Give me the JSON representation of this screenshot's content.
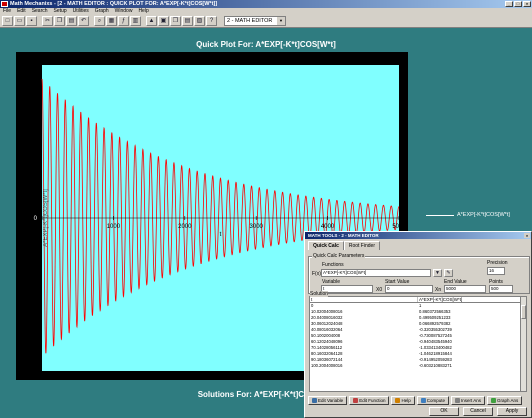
{
  "window": {
    "title": "Math Mechanixs - [2 - MATH EDITOR : QUICK PLOT FOR: A*EXP[-K*t]COS[W*t]]",
    "controls": [
      "_",
      "□",
      "×"
    ]
  },
  "menu": [
    "File",
    "Edit",
    "Search",
    "Setup",
    "Utilities",
    "Graph",
    "Window",
    "Help"
  ],
  "toolbar": {
    "combo_value": "2 - MATH EDITOR"
  },
  "plot": {
    "title": "Quick Plot For: A*EXP[-K*t]COS[W*t]",
    "footer": "Solutions For: A*EXP[-K*t]COS[W*t]",
    "legend": "A*EXP[-K*t]COS[W*t]",
    "ylabel": "A*EXP[-K*t]COS[W*t]",
    "xlabel": "t",
    "xticks": [
      "0",
      "1000",
      "2000",
      "3000",
      "4000",
      "5000"
    ],
    "y_zero_label": "0",
    "colors": {
      "background": "#80ffff",
      "curve": "#ff0000",
      "frame": "#000000",
      "axis": "#000000"
    }
  },
  "chart_data": {
    "type": "line",
    "title": "Quick Plot For: A*EXP[-K*t]COS[W*t]",
    "xlabel": "t",
    "ylabel": "A*EXP[-K*t]COS[W*t]",
    "xlim": [
      0,
      5000
    ],
    "ylim": [
      -1.1,
      1.1
    ],
    "grid": false,
    "legend_placement": "right-outside",
    "series": [
      {
        "name": "A*EXP[-K*t]COS[W*t]",
        "A": 1,
        "K": 0.0005,
        "cycles_over_range": 46
      }
    ]
  },
  "dialog": {
    "title": "MATH TOOLS - 2 - MATH EDITOR",
    "tabs": [
      "Quick Calc",
      "Root Finder"
    ],
    "params_group": "Quick Calc Parameters",
    "functions_label": "Functions",
    "fx_label": "F(x)",
    "fx_value": "A*EXP[-K*t]COS[W*t]",
    "precision_label": "Precision",
    "precision_value": "16",
    "variable_label": "Variable",
    "variable_value": "t",
    "start_label": "Start Value",
    "start_value": "0",
    "x0_label": "X0",
    "end_label": "End Value",
    "end_value": "5000",
    "xn_label": "Xn",
    "points_label": "Points",
    "points_value": "500",
    "solution_label": "Solution",
    "columns": [
      "t",
      "A*EXP[-K*t]COS[W*t]"
    ],
    "rows": [
      [
        "0",
        "1"
      ],
      [
        "10.02004008016",
        "0.860372566353"
      ],
      [
        "20.04008016032",
        "0.499509251233"
      ],
      [
        "30.06012024048",
        "0.066892579382"
      ],
      [
        "40.08016032064",
        "-0.320355302739"
      ],
      [
        "50.1002004008",
        "-0.730087527245"
      ],
      [
        "60.12024048096",
        "-0.940483545940"
      ],
      [
        "70.14028056112",
        "-1.033413400482"
      ],
      [
        "80.16032064128",
        "-1.046218915844"
      ],
      [
        "90.18036072144",
        "-0.914952059283"
      ],
      [
        "100.2004008016",
        "-0.603210883271"
      ]
    ],
    "actions": [
      "Edit Variable",
      "Edit Function",
      "Help",
      "Compute",
      "Insert Ans",
      "Graph Ans"
    ],
    "buttons": [
      "OK",
      "Cancel",
      "Apply"
    ]
  }
}
